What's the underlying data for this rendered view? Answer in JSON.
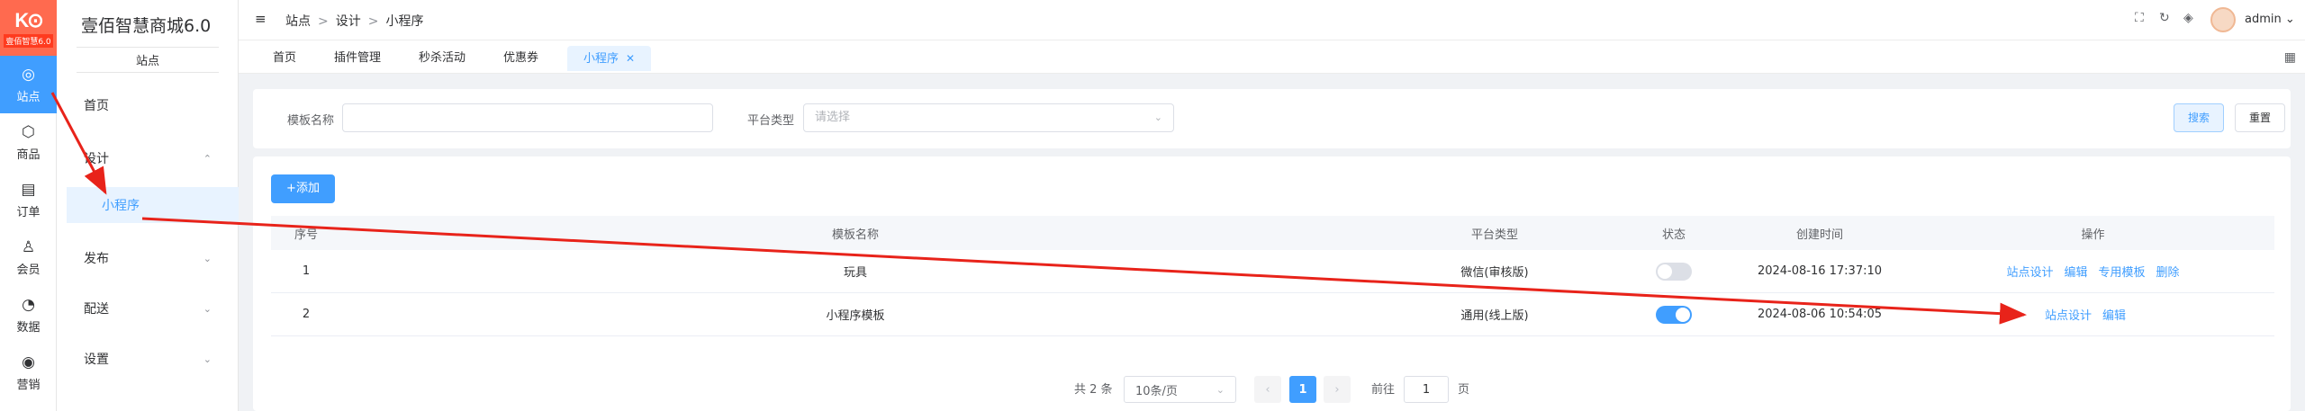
{
  "rail": {
    "logo_sub": "壹佰智慧6.0",
    "items": [
      {
        "label": "站点",
        "icon": "globe-icon",
        "glyph": "◎"
      },
      {
        "label": "商品",
        "icon": "cube-icon",
        "glyph": "⬡"
      },
      {
        "label": "订单",
        "icon": "clipboard-icon",
        "glyph": "▤"
      },
      {
        "label": "会员",
        "icon": "user-icon",
        "glyph": "♙"
      },
      {
        "label": "数据",
        "icon": "pie-icon",
        "glyph": "◔"
      },
      {
        "label": "营销",
        "icon": "target-icon",
        "glyph": "◉"
      }
    ]
  },
  "submenu": {
    "brand": "壹佰智慧商城6.0",
    "section": "站点",
    "items": [
      {
        "label": "首页"
      },
      {
        "label": "设计"
      },
      {
        "label": "小程序"
      },
      {
        "label": "发布"
      },
      {
        "label": "配送"
      },
      {
        "label": "设置"
      }
    ]
  },
  "header": {
    "breadcrumb": [
      "站点",
      "设计",
      "小程序"
    ],
    "separator": ">",
    "user": "admin"
  },
  "tabs": [
    {
      "label": "首页"
    },
    {
      "label": "插件管理"
    },
    {
      "label": "秒杀活动"
    },
    {
      "label": "优惠券"
    },
    {
      "label": "小程序",
      "active": true
    }
  ],
  "search": {
    "name_label": "模板名称",
    "name_value": "",
    "type_label": "平台类型",
    "type_placeholder": "请选择",
    "search_btn": "搜索",
    "reset_btn": "重置"
  },
  "table": {
    "add_btn": "+添加",
    "columns": [
      "序号",
      "模板名称",
      "平台类型",
      "状态",
      "创建时间",
      "操作"
    ],
    "rows": [
      {
        "index": "1",
        "name": "玩具",
        "platform": "微信(审核版)",
        "enabled": false,
        "created": "2024-08-16 17:37:10",
        "actions": [
          "站点设计",
          "编辑",
          "专用模板",
          "删除"
        ]
      },
      {
        "index": "2",
        "name": "小程序模板",
        "platform": "通用(线上版)",
        "enabled": true,
        "created": "2024-08-06 10:54:05",
        "actions": [
          "站点设计",
          "编辑"
        ]
      }
    ]
  },
  "pagination": {
    "total": "共 2 条",
    "page_size": "10条/页",
    "current": "1",
    "goto_label": "前往",
    "goto_value": "1",
    "page_suffix": "页"
  },
  "colors": {
    "primary": "#409eff",
    "logo": "#ff6a4f",
    "annotation": "#e8231a"
  }
}
